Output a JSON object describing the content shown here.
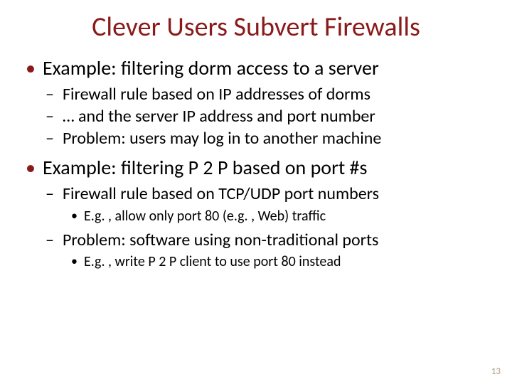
{
  "title": "Clever Users Subvert Firewalls",
  "bullets": [
    {
      "text": "Example: filtering dorm access to a server",
      "sub": [
        {
          "text": "Firewall rule based on IP addresses of dorms"
        },
        {
          "text": "… and the server IP address and port number"
        },
        {
          "text": "Problem: users may log in to another machine"
        }
      ]
    },
    {
      "text": "Example: filtering P 2 P based on port #s",
      "sub": [
        {
          "text": "Firewall rule based on TCP/UDP port numbers",
          "sub": [
            {
              "text": "E.g. , allow only port 80 (e.g. , Web) traffic"
            }
          ]
        },
        {
          "text": "Problem: software using non-traditional ports",
          "sub": [
            {
              "text": "E.g. , write P 2 P client to use port 80 instead"
            }
          ]
        }
      ]
    }
  ],
  "page_number": "13"
}
